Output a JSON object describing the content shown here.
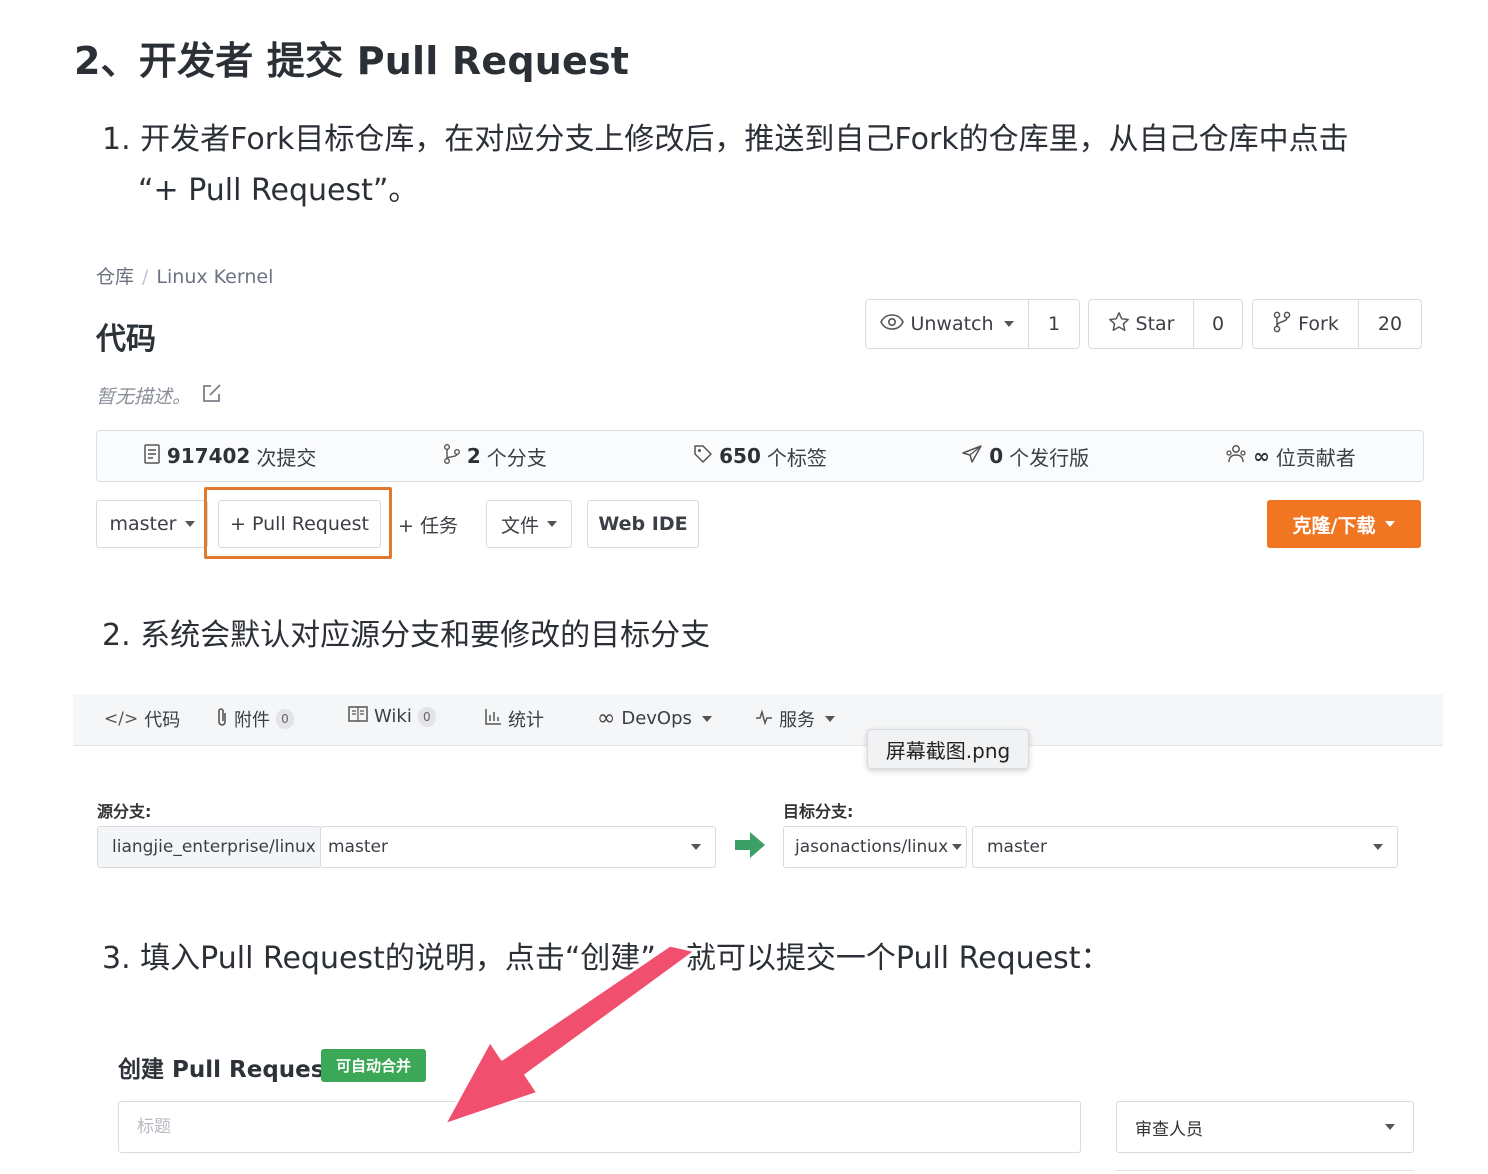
{
  "heading": "2、开发者 提交 Pull Request",
  "steps": [
    {
      "num": "1.",
      "line1": "开发者Fork目标仓库，在对应分支上修改后，推送到自己Fork的仓库里，从自己仓库中点击",
      "line2": "“+ Pull Request”。"
    },
    {
      "num": "2.",
      "text": "系统会默认对应源分支和要修改的目标分支"
    },
    {
      "num": "3.",
      "text": "填入Pull Request的说明，点击“创建”，就可以提交一个Pull Request："
    }
  ],
  "repo": {
    "breadcrumb": [
      "仓库",
      "Linux Kernel"
    ],
    "title": "代码",
    "description": "暂无描述。",
    "watch": {
      "label": "Unwatch",
      "count": "1"
    },
    "star": {
      "label": "Star",
      "count": "0"
    },
    "fork": {
      "label": "Fork",
      "count": "20"
    },
    "stats": [
      {
        "value": "917402",
        "label": "次提交",
        "icon": "commit-icon"
      },
      {
        "value": "2",
        "label": "个分支",
        "icon": "branch-icon"
      },
      {
        "value": "650",
        "label": "个标签",
        "icon": "tag-icon"
      },
      {
        "value": "0",
        "label": "个发行版",
        "icon": "release-icon"
      },
      {
        "value": "∞",
        "label": "位贡献者",
        "icon": "contributors-icon"
      }
    ],
    "toolbar": {
      "branch": "master",
      "pull_request": "+ Pull Request",
      "task": "+ 任务",
      "file": "文件",
      "web_ide": "Web IDE",
      "clone": "克隆/下载"
    },
    "accent_color": "#f07622",
    "highlight_color": "#e07a2e"
  },
  "pr_page": {
    "tabs": [
      {
        "label": "代码",
        "icon": "code-icon"
      },
      {
        "label": "附件",
        "badge": "0",
        "icon": "attachment-icon"
      },
      {
        "label": "Wiki",
        "badge": "0",
        "icon": "wiki-icon"
      },
      {
        "label": "统计",
        "icon": "chart-icon"
      },
      {
        "label": "DevOps",
        "icon": "infinity-icon"
      },
      {
        "label": "服务",
        "icon": "pulse-icon"
      }
    ],
    "tooltip": "屏幕截图.png",
    "source_label": "源分支:",
    "source_repo": "liangjie_enterprise/linux",
    "source_branch": "master",
    "target_label": "目标分支:",
    "target_repo": "jasonactions/linux",
    "target_branch": "master"
  },
  "create_pr": {
    "title": "创建 Pull Request",
    "badge": "可自动合并",
    "badge_color": "#3aa856",
    "title_placeholder": "标题",
    "reviewer": "审查人员",
    "arrow_color": "#f0506e"
  }
}
